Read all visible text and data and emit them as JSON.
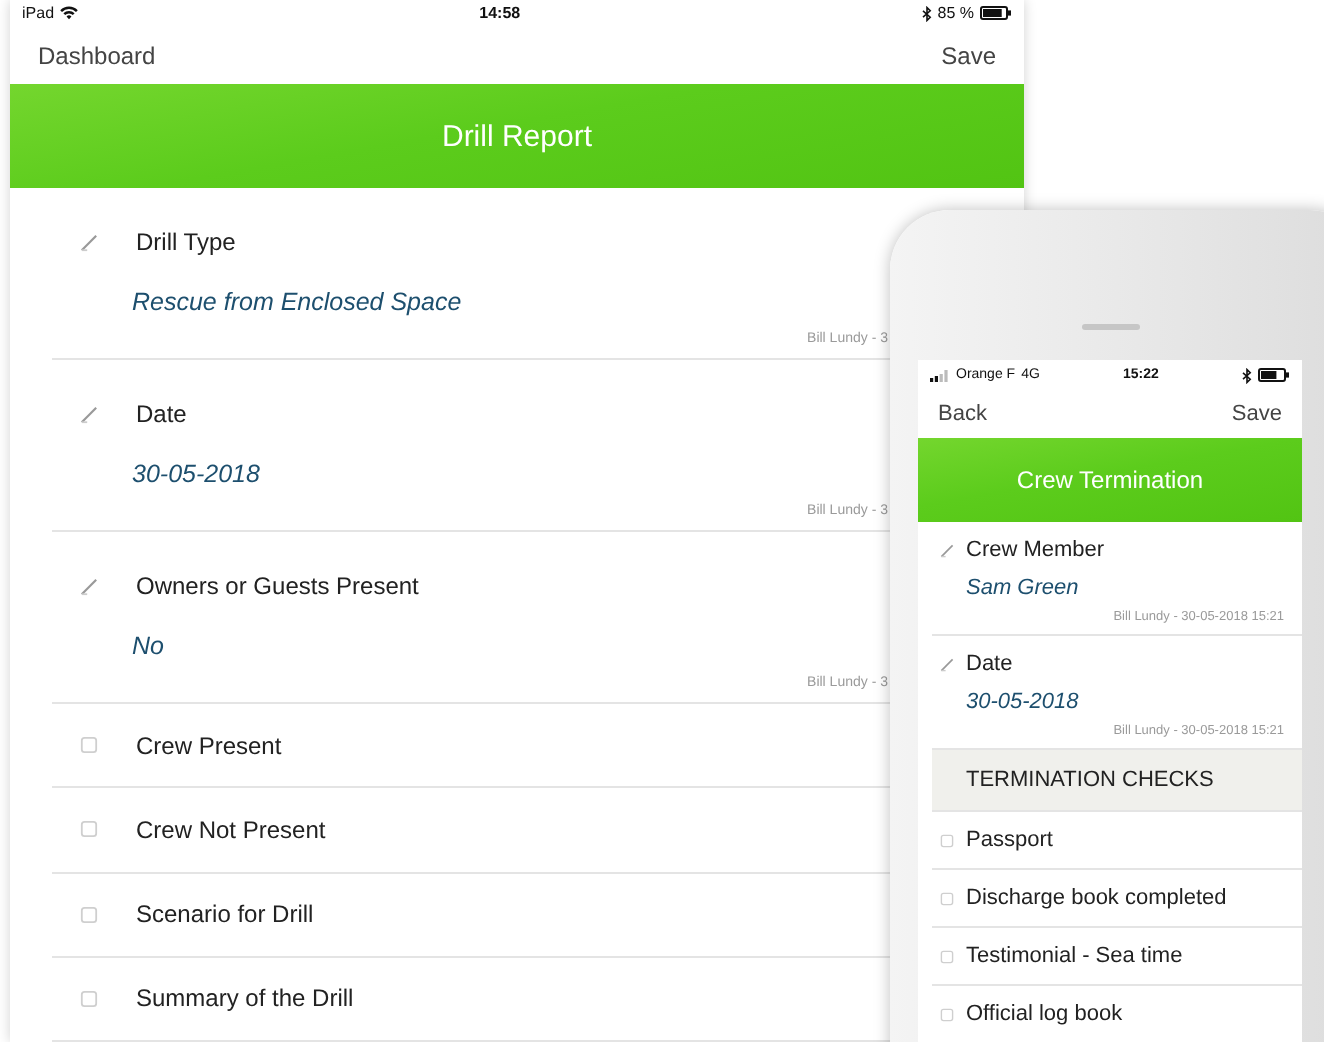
{
  "tablet": {
    "status_bar": {
      "device": "iPad",
      "time": "14:58",
      "battery": "85 %"
    },
    "nav": {
      "back": "Dashboard",
      "action": "Save"
    },
    "title": "Drill Report",
    "items": [
      {
        "kind": "field",
        "label": "Drill Type",
        "value": "Rescue from Enclosed Space",
        "footer": "Bill Lundy - 3"
      },
      {
        "kind": "field",
        "label": "Date",
        "value": "30-05-2018",
        "footer": "Bill Lundy - 3"
      },
      {
        "kind": "field",
        "label": "Owners or Guests Present",
        "value": "No",
        "footer": "Bill Lundy - 3"
      },
      {
        "kind": "check",
        "label": "Crew Present"
      },
      {
        "kind": "check",
        "label": "Crew Not Present"
      },
      {
        "kind": "check",
        "label": "Scenario for Drill"
      },
      {
        "kind": "check",
        "label": "Summary of the Drill"
      }
    ]
  },
  "phone": {
    "status_bar": {
      "carrier": "Orange F",
      "network": "4G",
      "time": "15:22"
    },
    "nav": {
      "back": "Back",
      "action": "Save"
    },
    "title": "Crew Termination",
    "items": [
      {
        "kind": "field",
        "label": "Crew Member",
        "value": "Sam Green",
        "footer": "Bill Lundy - 30-05-2018 15:21"
      },
      {
        "kind": "field",
        "label": "Date",
        "value": "30-05-2018",
        "footer": "Bill Lundy - 30-05-2018 15:21"
      },
      {
        "kind": "section",
        "label": "TERMINATION CHECKS"
      },
      {
        "kind": "check",
        "label": "Passport"
      },
      {
        "kind": "check",
        "label": "Discharge book completed"
      },
      {
        "kind": "check",
        "label": "Testimonial - Sea time"
      },
      {
        "kind": "check",
        "label": "Official log book"
      }
    ]
  }
}
